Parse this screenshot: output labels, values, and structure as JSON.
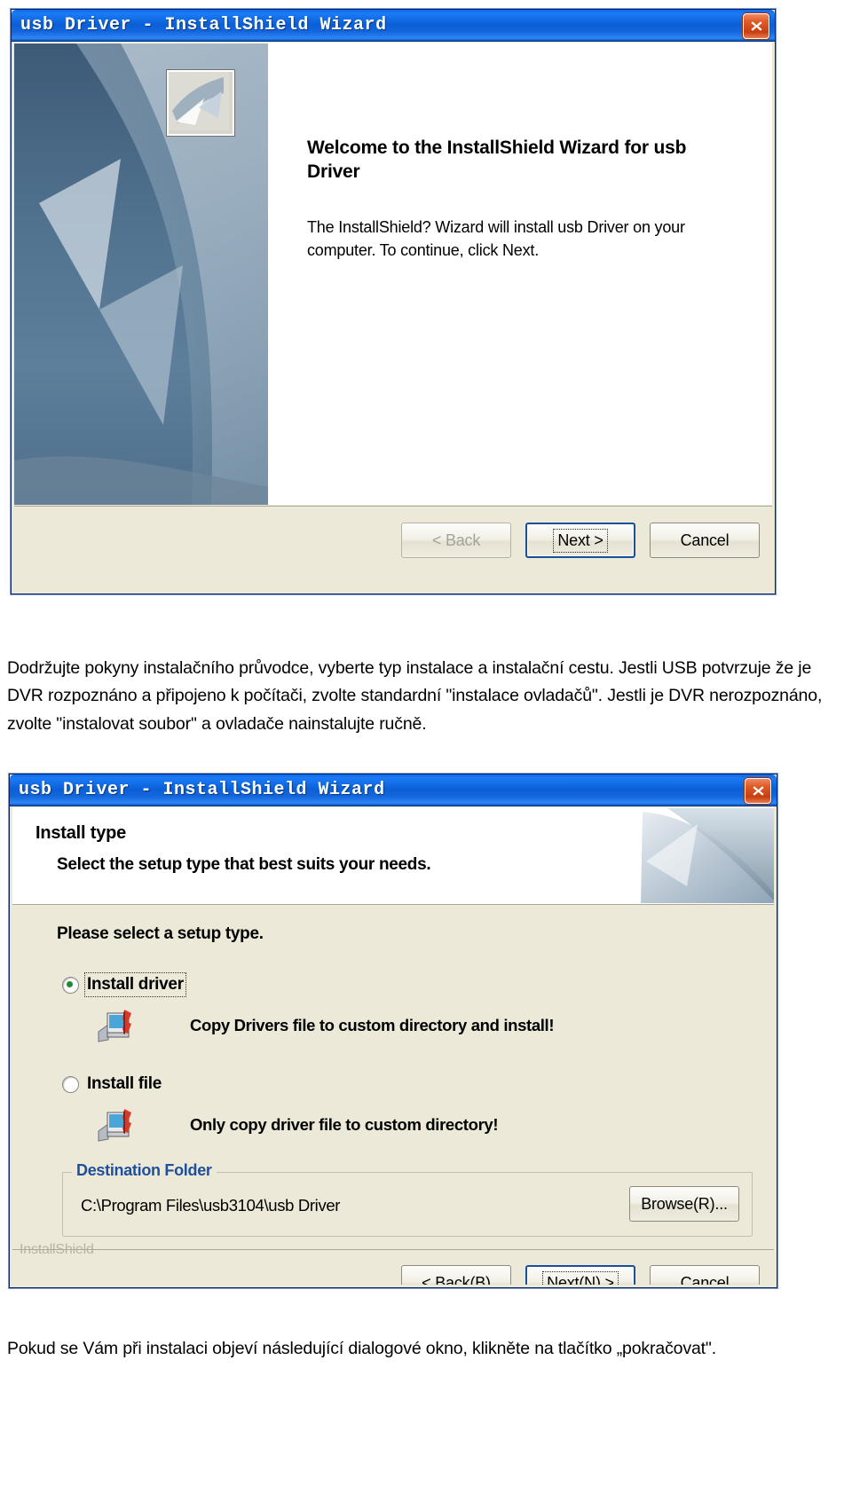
{
  "dialog1": {
    "title": "usb Driver - InstallShield Wizard",
    "close_icon": "close-icon",
    "heading": "Welcome to the InstallShield Wizard for usb Driver",
    "body_text": "The InstallShield? Wizard will install usb Driver on your computer.  To continue, click Next.",
    "buttons": {
      "back": "< Back",
      "back_accel": "B",
      "next": "Next >",
      "cancel": "Cancel"
    },
    "colors": {
      "titlebar": "#0b5fd6",
      "close_button": "#c63f12",
      "panel": "#ece9d8",
      "side_panel": "#51738f"
    }
  },
  "paragraph1": "Dodržujte pokyny instalačního průvodce, vyberte typ instalace a instalační cestu.  Jestli USB potvrzuje že je DVR rozpoznáno a připojeno k počítači, zvolte standardní \"instalace ovladačů\".    Jestli je DVR nerozpoznáno, zvolte \"instalovat soubor\" a ovladače nainstalujte ručně.",
  "dialog2": {
    "title": "usb Driver - InstallShield Wizard",
    "close_icon": "close-icon",
    "header_title": "Install type",
    "header_subtitle": "Select the setup type that best suits your needs.",
    "prompt": "Please select a setup type.",
    "options": [
      {
        "label": "Install driver",
        "selected": true,
        "focused": true,
        "description": "Copy Drivers file to custom directory and install!",
        "icon": "install-driver-icon"
      },
      {
        "label": "Install file",
        "selected": false,
        "focused": false,
        "description": "Only copy driver file to custom directory!",
        "icon": "copy-file-icon"
      }
    ],
    "destination": {
      "legend": "Destination Folder",
      "path": "C:\\Program Files\\usb3104\\usb Driver",
      "browse_label": "Browse(R)...",
      "browse_accel": "R"
    },
    "brand": "InstallShield",
    "buttons": {
      "back": "< Back(B)",
      "back_accel": "B",
      "next": "Next(N) >",
      "next_accel": "N",
      "cancel": "Cancel"
    },
    "colors": {
      "legend_text": "#1d4f9c",
      "radio_dot": "#1f8b2f",
      "default_button_border": "#1b4f9c"
    }
  },
  "paragraph2": "Pokud se Vám při instalaci objeví následující dialogové okno, klikněte na tlačítko „pokračovat\"."
}
